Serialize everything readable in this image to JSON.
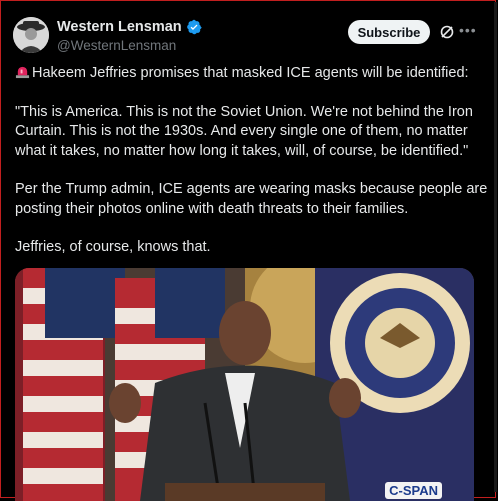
{
  "author": {
    "display_name": "Western Lensman",
    "handle": "@WesternLensman",
    "verified": true
  },
  "actions": {
    "subscribe_label": "Subscribe",
    "grok_icon": "grok-icon",
    "more_icon": "more-icon"
  },
  "tweet": {
    "line1": "Hakeem Jeffries promises that masked ICE agents will be identified:",
    "line2": "\"This is America. This is not the Soviet Union. We're not behind the Iron Curtain. This is not the 1930s. And every single one of them, no matter what it takes, no matter how long it takes, will, of course, be identified.\"",
    "line3": "Per the Trump admin, ICE agents are wearing masks because people are posting their photos online with death threats to their families.",
    "line4": "Jeffries, of course, knows that."
  },
  "media": {
    "badge": "C-SPAN",
    "description_icon": "video-thumbnail"
  },
  "colors": {
    "background": "#000000",
    "text": "#e7e9ea",
    "secondary": "#71767b",
    "verified": "#1d9bf0",
    "frame_border": "#c11f1f"
  }
}
